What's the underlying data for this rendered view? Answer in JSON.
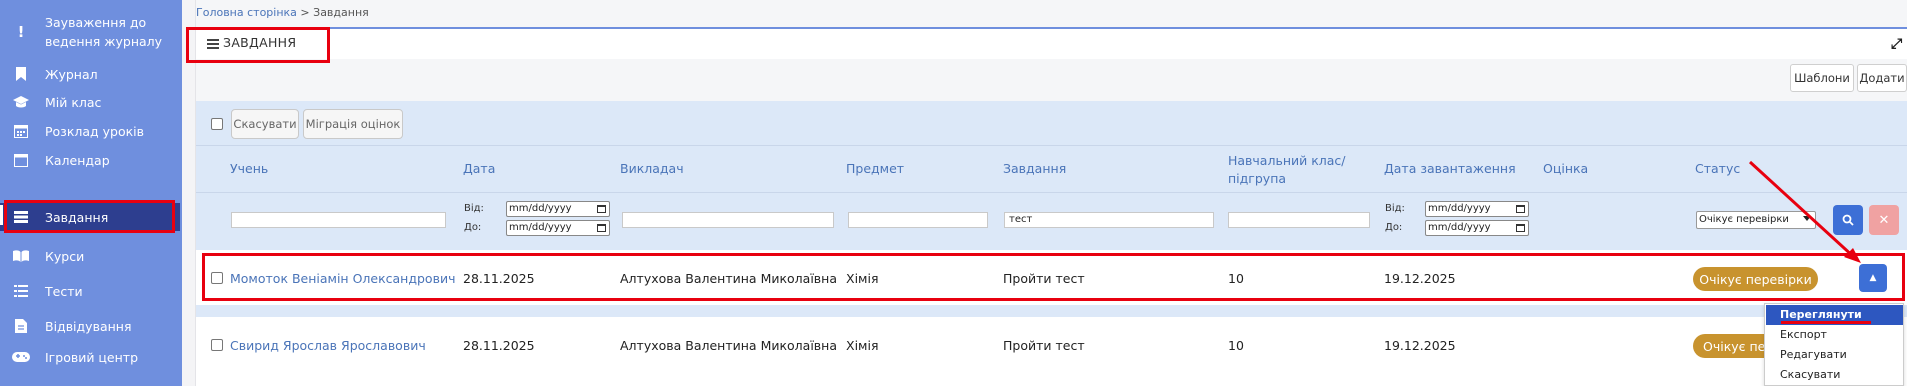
{
  "sidebar": {
    "items": [
      {
        "label": "Зауваження до ведення журналу",
        "icon": "exclamation-icon"
      },
      {
        "label": "Журнал",
        "icon": "bookmark-icon"
      },
      {
        "label": "Мій клас",
        "icon": "graduation-cap-icon"
      },
      {
        "label": "Розклад уроків",
        "icon": "calendar-grid-icon"
      },
      {
        "label": "Календар",
        "icon": "calendar-icon"
      },
      {
        "label": "Завдання",
        "icon": "tasks-icon",
        "active": true
      },
      {
        "label": "Курси",
        "icon": "book-open-icon"
      },
      {
        "label": "Тести",
        "icon": "list-icon"
      },
      {
        "label": "Відвідування",
        "icon": "file-icon"
      },
      {
        "label": "Ігровий центр",
        "icon": "gamepad-icon"
      }
    ]
  },
  "breadcrumb": {
    "home": "Головна сторінка",
    "separator": ">",
    "current": "Завдання"
  },
  "page_title": "ЗАВДАННЯ",
  "toolbar": {
    "templates_label": "Шаблони",
    "add_label": "Додати"
  },
  "bulk_actions": {
    "cancel_label": "Скасувати",
    "migrate_label": "Міграція оцінок"
  },
  "columns": {
    "student": "Учень",
    "date": "Дата",
    "teacher": "Викладач",
    "subject": "Предмет",
    "task": "Завдання",
    "class_line1": "Навчальний клас/",
    "class_line2": "підгрупа",
    "upload_date": "Дата завантаження",
    "grade": "Оцінка",
    "status": "Статус"
  },
  "filters": {
    "from_label": "Від:",
    "to_label": "До:",
    "date_placeholder": "mm/dd/yyyy",
    "task_value": "тест",
    "status_selected": "Очікує перевірки"
  },
  "rows": [
    {
      "student": "Момоток Веніамін Олександрович",
      "date": "28.11.2025",
      "teacher": "Алтухова Валентина Миколаївна",
      "subject": "Хімія",
      "task": "Пройти тест",
      "class": "10",
      "upload_date": "19.12.2025",
      "grade": "",
      "status": "Очікує перевірки"
    },
    {
      "student": "Свирид Ярослав Ярославович",
      "date": "28.11.2025",
      "teacher": "Алтухова Валентина Миколаївна",
      "subject": "Хімія",
      "task": "Пройти тест",
      "class": "10",
      "upload_date": "19.12.2025",
      "grade": "",
      "status": "Очікує пер"
    }
  ],
  "action_menu": {
    "view": "Переглянути",
    "export": "Експорт",
    "edit": "Редагувати",
    "cancel": "Скасувати"
  },
  "colors": {
    "sidebar": "#6f8fde",
    "sidebar_active": "#2d3e8f",
    "accent": "#3d6fd6",
    "status_badge": "#c8932e",
    "annotation": "#e8000f",
    "link": "#4a74b8"
  }
}
